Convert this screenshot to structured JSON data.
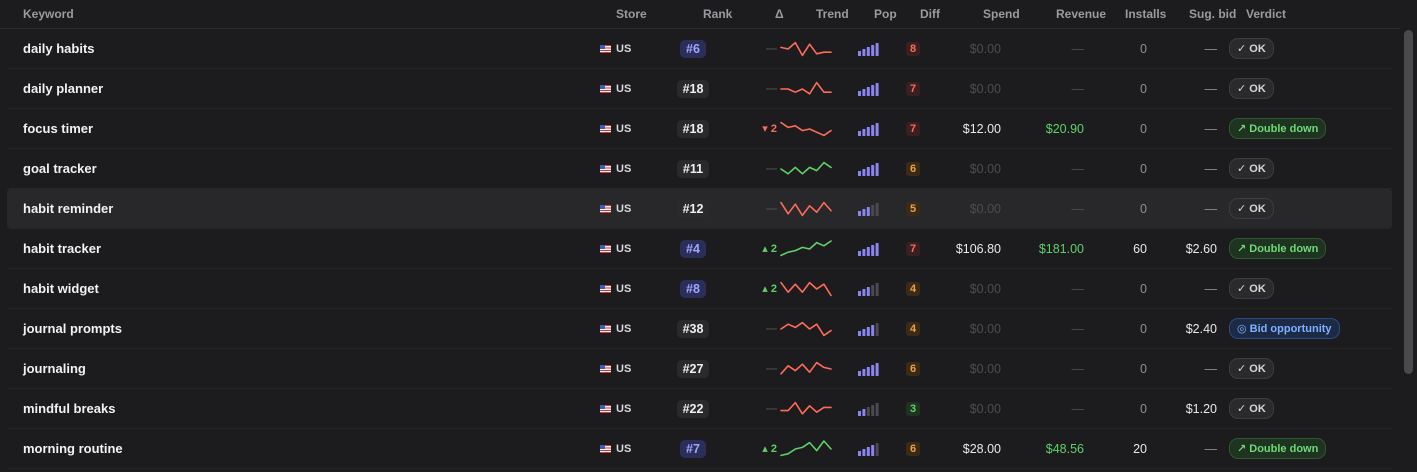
{
  "columns": {
    "keyword": "Keyword",
    "store": "Store",
    "rank": "Rank",
    "delta": "Δ",
    "trend": "Trend",
    "pop": "Pop",
    "diff": "Diff",
    "spend": "Spend",
    "revenue": "Revenue",
    "installs": "Installs",
    "sug_bid": "Sug. bid",
    "verdict": "Verdict"
  },
  "colors": {
    "rank_top_text": "#9ea6ff",
    "trend_up": "#5fd068",
    "trend_down": "#ff6b5a",
    "pop_on": "#8b85f0",
    "pop_off": "#4a4a50",
    "diff_high_bg": "#3a1f1f",
    "diff_high_fg": "#ff6b5a",
    "diff_mid_bg": "#3a2a18",
    "diff_mid_fg": "#f0a040",
    "diff_low_bg": "#1f3322",
    "diff_low_fg": "#5fd068"
  },
  "rows": [
    {
      "keyword": "daily habits",
      "store": "US",
      "rank": "#6",
      "rank_top": true,
      "delta": "—",
      "delta_dir": "none",
      "trend": [
        0.6,
        0.5,
        0.9,
        0.1,
        0.8,
        0.2,
        0.3,
        0.3
      ],
      "trend_color": "down",
      "pop": 5,
      "diff": "8",
      "diff_level": "high",
      "spend": "$0.00",
      "revenue": "—",
      "installs": "0",
      "sug_bid": "—",
      "verdict": "✓ OK",
      "verdict_type": "ok"
    },
    {
      "keyword": "daily planner",
      "store": "US",
      "rank": "#18",
      "rank_top": false,
      "delta": "—",
      "delta_dir": "none",
      "trend": [
        0.5,
        0.5,
        0.3,
        0.5,
        0.2,
        0.9,
        0.3,
        0.3
      ],
      "trend_color": "down",
      "pop": 5,
      "diff": "7",
      "diff_level": "high",
      "spend": "$0.00",
      "revenue": "—",
      "installs": "0",
      "sug_bid": "—",
      "verdict": "✓ OK",
      "verdict_type": "ok"
    },
    {
      "keyword": "focus timer",
      "store": "US",
      "rank": "#18",
      "rank_top": false,
      "delta": "▾ 2",
      "delta_dir": "down",
      "trend": [
        0.9,
        0.6,
        0.7,
        0.4,
        0.5,
        0.3,
        0.1,
        0.4
      ],
      "trend_color": "down",
      "pop": 5,
      "diff": "7",
      "diff_level": "high",
      "spend": "$12.00",
      "revenue": "$20.90",
      "installs": "0",
      "sug_bid": "—",
      "verdict": "↗ Double down",
      "verdict_type": "dd"
    },
    {
      "keyword": "goal tracker",
      "store": "US",
      "rank": "#11",
      "rank_top": false,
      "delta": "—",
      "delta_dir": "none",
      "trend": [
        0.5,
        0.2,
        0.6,
        0.2,
        0.6,
        0.4,
        0.9,
        0.6
      ],
      "trend_color": "up",
      "pop": 5,
      "diff": "6",
      "diff_level": "mid",
      "spend": "$0.00",
      "revenue": "—",
      "installs": "0",
      "sug_bid": "—",
      "verdict": "✓ OK",
      "verdict_type": "ok"
    },
    {
      "keyword": "habit reminder",
      "store": "US",
      "rank": "#12",
      "rank_top": false,
      "delta": "—",
      "delta_dir": "none",
      "trend": [
        0.9,
        0.2,
        0.8,
        0.1,
        0.7,
        0.3,
        0.9,
        0.4
      ],
      "trend_color": "down",
      "pop": 3,
      "diff": "5",
      "diff_level": "mid",
      "spend": "$0.00",
      "revenue": "—",
      "installs": "0",
      "sug_bid": "—",
      "verdict": "✓ OK",
      "verdict_type": "ok",
      "highlight": true
    },
    {
      "keyword": "habit tracker",
      "store": "US",
      "rank": "#4",
      "rank_top": true,
      "delta": "▴ 2",
      "delta_dir": "up",
      "trend": [
        0.1,
        0.3,
        0.4,
        0.6,
        0.5,
        0.9,
        0.7,
        1.0
      ],
      "trend_color": "up",
      "pop": 5,
      "diff": "7",
      "diff_level": "high",
      "spend": "$106.80",
      "revenue": "$181.00",
      "installs": "60",
      "sug_bid": "$2.60",
      "verdict": "↗ Double down",
      "verdict_type": "dd"
    },
    {
      "keyword": "habit widget",
      "store": "US",
      "rank": "#8",
      "rank_top": true,
      "delta": "▴ 2",
      "delta_dir": "up",
      "trend": [
        0.9,
        0.3,
        0.8,
        0.3,
        0.9,
        0.5,
        0.8,
        0.1
      ],
      "trend_color": "down",
      "pop": 3,
      "diff": "4",
      "diff_level": "mid",
      "spend": "$0.00",
      "revenue": "—",
      "installs": "0",
      "sug_bid": "—",
      "verdict": "✓ OK",
      "verdict_type": "ok"
    },
    {
      "keyword": "journal prompts",
      "store": "US",
      "rank": "#38",
      "rank_top": false,
      "delta": "—",
      "delta_dir": "none",
      "trend": [
        0.5,
        0.8,
        0.6,
        0.9,
        0.5,
        0.8,
        0.1,
        0.4
      ],
      "trend_color": "down",
      "pop": 4,
      "diff": "4",
      "diff_level": "mid",
      "spend": "$0.00",
      "revenue": "—",
      "installs": "0",
      "sug_bid": "$2.40",
      "verdict": "◎ Bid opportunity",
      "verdict_type": "bo"
    },
    {
      "keyword": "journaling",
      "store": "US",
      "rank": "#27",
      "rank_top": false,
      "delta": "—",
      "delta_dir": "none",
      "trend": [
        0.2,
        0.7,
        0.4,
        0.8,
        0.3,
        0.9,
        0.6,
        0.5
      ],
      "trend_color": "down",
      "pop": 5,
      "diff": "6",
      "diff_level": "mid",
      "spend": "$0.00",
      "revenue": "—",
      "installs": "0",
      "sug_bid": "—",
      "verdict": "✓ OK",
      "verdict_type": "ok"
    },
    {
      "keyword": "mindful breaks",
      "store": "US",
      "rank": "#22",
      "rank_top": false,
      "delta": "—",
      "delta_dir": "none",
      "trend": [
        0.4,
        0.4,
        0.9,
        0.2,
        0.7,
        0.3,
        0.6,
        0.6
      ],
      "trend_color": "down",
      "pop": 2,
      "diff": "3",
      "diff_level": "low",
      "spend": "$0.00",
      "revenue": "—",
      "installs": "0",
      "sug_bid": "$1.20",
      "verdict": "✓ OK",
      "verdict_type": "ok"
    },
    {
      "keyword": "morning routine",
      "store": "US",
      "rank": "#7",
      "rank_top": true,
      "delta": "▴ 2",
      "delta_dir": "up",
      "trend": [
        0.1,
        0.2,
        0.5,
        0.6,
        0.9,
        0.4,
        1.0,
        0.5
      ],
      "trend_color": "up",
      "pop": 4,
      "diff": "6",
      "diff_level": "mid",
      "spend": "$28.00",
      "revenue": "$48.56",
      "installs": "20",
      "sug_bid": "—",
      "verdict": "↗ Double down",
      "verdict_type": "dd"
    }
  ]
}
